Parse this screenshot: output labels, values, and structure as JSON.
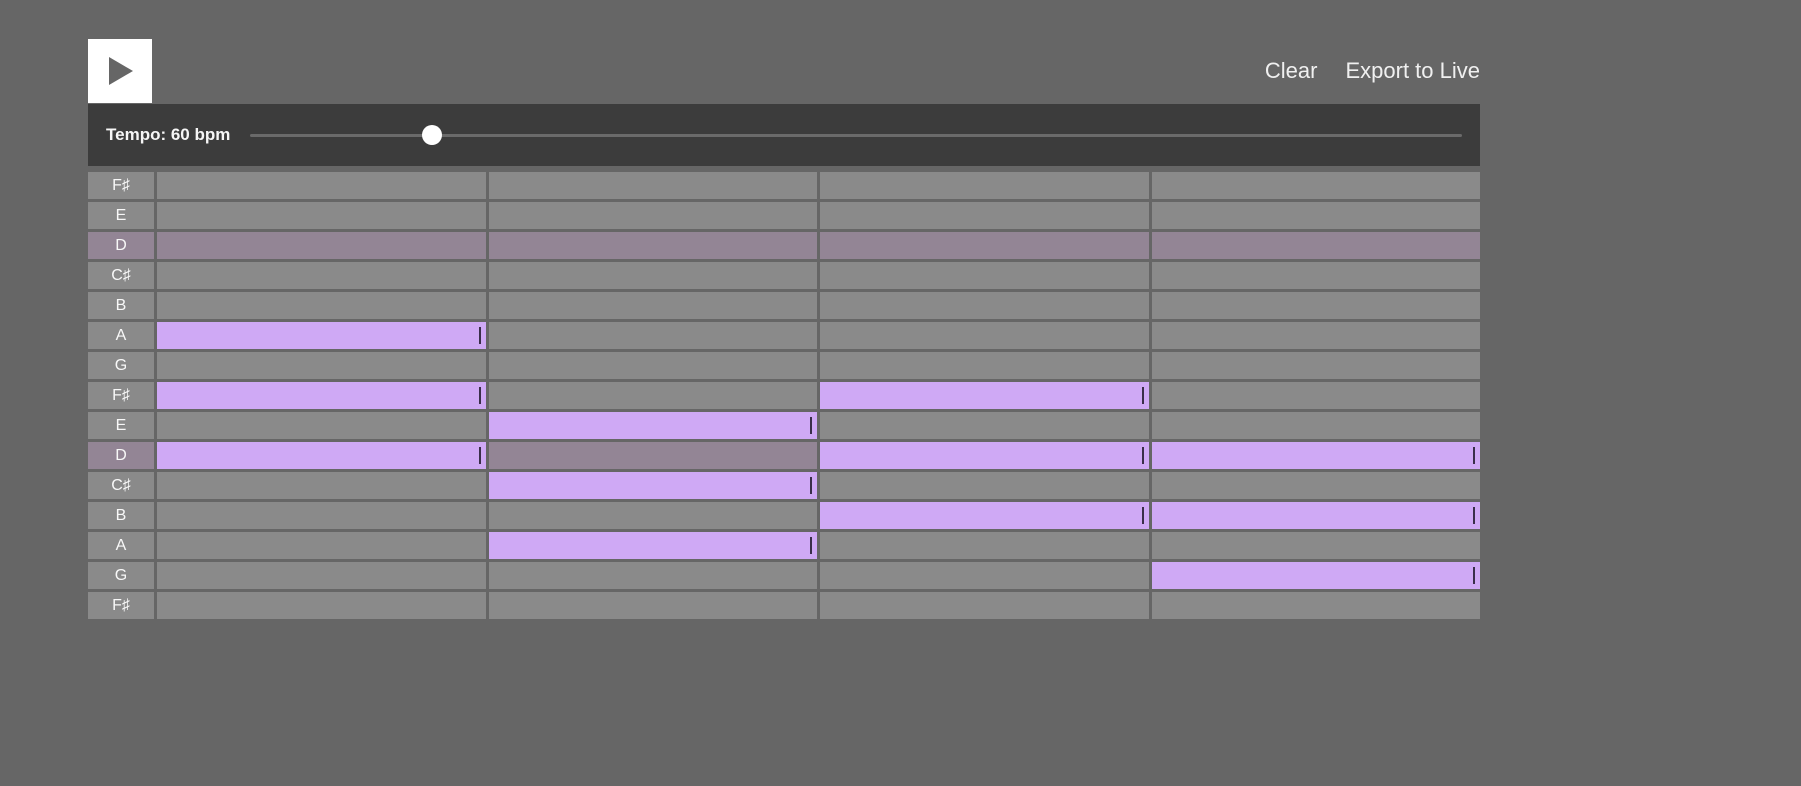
{
  "toolbar": {
    "clear_label": "Clear",
    "export_label": "Export to Live"
  },
  "tempo": {
    "label": "Tempo: 60 bpm",
    "value": 60,
    "min": 40,
    "max": 200,
    "slider_percent": 15
  },
  "colors": {
    "note": "#cfa9f5",
    "row": "#8a8a8a",
    "root_row": "#938595",
    "tempo_bar": "#3c3c3c"
  },
  "grid": {
    "columns": 4,
    "root_note": "D",
    "rows": [
      {
        "label": "F♯",
        "is_root": false,
        "cells": [
          false,
          false,
          false,
          false
        ]
      },
      {
        "label": "E",
        "is_root": false,
        "cells": [
          false,
          false,
          false,
          false
        ]
      },
      {
        "label": "D",
        "is_root": true,
        "cells": [
          false,
          false,
          false,
          false
        ]
      },
      {
        "label": "C♯",
        "is_root": false,
        "cells": [
          false,
          false,
          false,
          false
        ]
      },
      {
        "label": "B",
        "is_root": false,
        "cells": [
          false,
          false,
          false,
          false
        ]
      },
      {
        "label": "A",
        "is_root": false,
        "cells": [
          true,
          false,
          false,
          false
        ]
      },
      {
        "label": "G",
        "is_root": false,
        "cells": [
          false,
          false,
          false,
          false
        ]
      },
      {
        "label": "F♯",
        "is_root": false,
        "cells": [
          true,
          false,
          true,
          false
        ]
      },
      {
        "label": "E",
        "is_root": false,
        "cells": [
          false,
          true,
          false,
          false
        ]
      },
      {
        "label": "D",
        "is_root": true,
        "cells": [
          true,
          false,
          true,
          true
        ]
      },
      {
        "label": "C♯",
        "is_root": false,
        "cells": [
          false,
          true,
          false,
          false
        ]
      },
      {
        "label": "B",
        "is_root": false,
        "cells": [
          false,
          false,
          true,
          true
        ]
      },
      {
        "label": "A",
        "is_root": false,
        "cells": [
          false,
          true,
          false,
          false
        ]
      },
      {
        "label": "G",
        "is_root": false,
        "cells": [
          false,
          false,
          false,
          true
        ]
      },
      {
        "label": "F♯",
        "is_root": false,
        "cells": [
          false,
          false,
          false,
          false
        ]
      }
    ]
  }
}
